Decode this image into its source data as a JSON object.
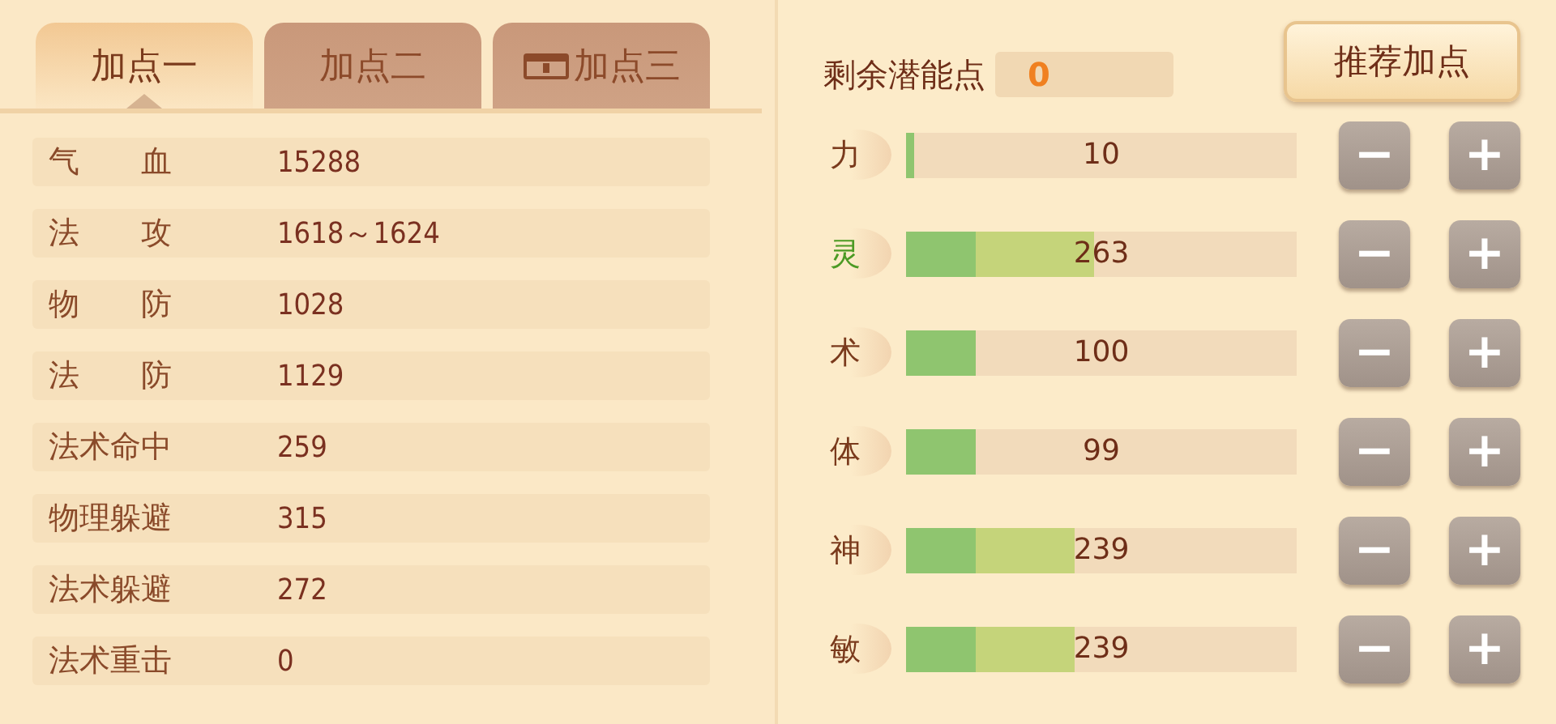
{
  "tabs": [
    {
      "label": "加点一",
      "selected": true,
      "locked": false
    },
    {
      "label": "加点二",
      "selected": false,
      "locked": false
    },
    {
      "label": "加点三",
      "selected": false,
      "locked": true
    }
  ],
  "stats": [
    {
      "label": "气　　血",
      "value": "15288"
    },
    {
      "label": "法　　攻",
      "value": "1618～1624"
    },
    {
      "label": "物　　防",
      "value": "1028"
    },
    {
      "label": "法　　防",
      "value": "1129"
    },
    {
      "label": "法术命中",
      "value": "259"
    },
    {
      "label": "物理躲避",
      "value": "315"
    },
    {
      "label": "法术躲避",
      "value": "272"
    },
    {
      "label": "法术重击",
      "value": "0"
    }
  ],
  "remaining": {
    "label": "剩余潜能点",
    "value": "0"
  },
  "recommend_button": "推荐加点",
  "attributes": [
    {
      "name": "力",
      "highlighted": false,
      "value": "10",
      "base": {
        "level": 0.02
      },
      "minus": "−",
      "plus": "+"
    },
    {
      "name": "灵",
      "highlighted": true,
      "value": "263",
      "base": {
        "level": 0.18
      },
      "total": {
        "level": 0.48
      },
      "minus": "−",
      "plus": "+"
    },
    {
      "name": "术",
      "highlighted": false,
      "value": "100",
      "base": {
        "level": 0.18
      },
      "minus": "−",
      "plus": "+"
    },
    {
      "name": "体",
      "highlighted": false,
      "value": "99",
      "base": {
        "level": 0.18
      },
      "minus": "−",
      "plus": "+"
    },
    {
      "name": "神",
      "highlighted": false,
      "value": "239",
      "base": {
        "level": 0.18
      },
      "total": {
        "level": 0.43
      },
      "minus": "−",
      "plus": "+"
    },
    {
      "name": "敏",
      "highlighted": false,
      "value": "239",
      "base": {
        "level": 0.18
      },
      "total": {
        "level": 0.43
      },
      "minus": "−",
      "plus": "+"
    }
  ]
}
